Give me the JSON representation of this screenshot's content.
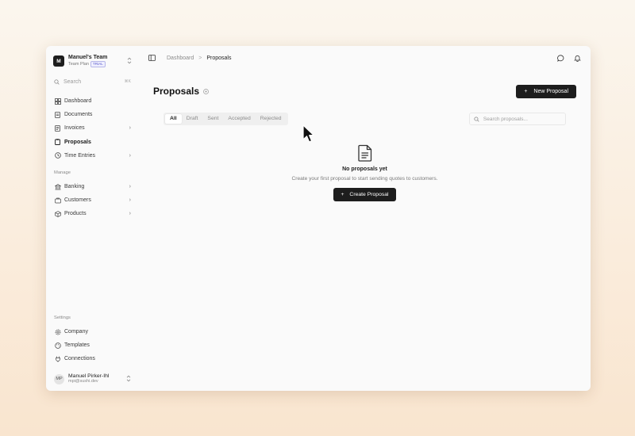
{
  "team": {
    "avatar_letter": "M",
    "name": "Manuel's Team",
    "plan": "Team Plan",
    "badge": "TRIAL"
  },
  "sidebar": {
    "search_label": "Search",
    "search_shortcut": "⌘K",
    "main_items": [
      {
        "label": "Dashboard",
        "icon": "grid-icon",
        "chevron": false
      },
      {
        "label": "Documents",
        "icon": "document-icon",
        "chevron": false
      },
      {
        "label": "Invoices",
        "icon": "invoice-icon",
        "chevron": true
      },
      {
        "label": "Proposals",
        "icon": "clipboard-icon",
        "chevron": false,
        "active": true
      },
      {
        "label": "Time Entries",
        "icon": "clock-icon",
        "chevron": true
      }
    ],
    "manage_label": "Manage",
    "manage_items": [
      {
        "label": "Banking",
        "icon": "bank-icon",
        "chevron": true
      },
      {
        "label": "Customers",
        "icon": "users-icon",
        "chevron": true
      },
      {
        "label": "Products",
        "icon": "box-icon",
        "chevron": true
      }
    ],
    "settings_label": "Settings",
    "settings_items": [
      {
        "label": "Company",
        "icon": "gear-icon"
      },
      {
        "label": "Templates",
        "icon": "palette-icon"
      },
      {
        "label": "Connections",
        "icon": "plug-icon"
      }
    ]
  },
  "user": {
    "initials": "MP",
    "name": "Manuel Pirker-Ihl",
    "email": "mpi@sushi.dev"
  },
  "breadcrumb": {
    "parent": "Dashboard",
    "separator": ">",
    "current": "Proposals"
  },
  "page": {
    "title": "Proposals",
    "new_button_label": "New Proposal",
    "filter_tabs": [
      "All",
      "Draft",
      "Sent",
      "Accepted",
      "Rejected"
    ],
    "active_tab": "All",
    "search_placeholder": "Search proposals...",
    "empty_title": "No proposals yet",
    "empty_description": "Create your first proposal to start sending quotes to customers.",
    "create_button_label": "Create Proposal"
  },
  "colors": {
    "accent_dark": "#1d1d1d",
    "trial_badge": "#5b5bc9"
  }
}
